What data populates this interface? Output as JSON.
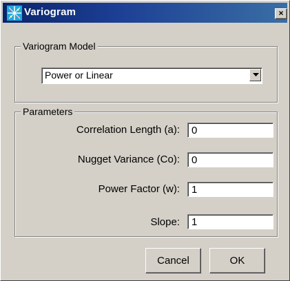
{
  "window": {
    "title": "Variogram",
    "close_label": "×"
  },
  "model_group": {
    "legend": "Variogram Model",
    "selected": "Power or Linear"
  },
  "params_group": {
    "legend": "Parameters",
    "fields": [
      {
        "label": "Correlation Length (a):",
        "value": "0"
      },
      {
        "label": "Nugget Variance (Co):",
        "value": "0"
      },
      {
        "label": "Power Factor (w):",
        "value": "1"
      },
      {
        "label": "Slope:",
        "value": "1"
      }
    ]
  },
  "buttons": {
    "cancel": "Cancel",
    "ok": "OK"
  },
  "colors": {
    "titlebar_start": "#0a246a",
    "titlebar_end": "#3a6ea5",
    "face": "#d4d0c8"
  },
  "icons": {
    "title": "variogram-app-icon",
    "dropdown": "chevron-down-icon"
  }
}
